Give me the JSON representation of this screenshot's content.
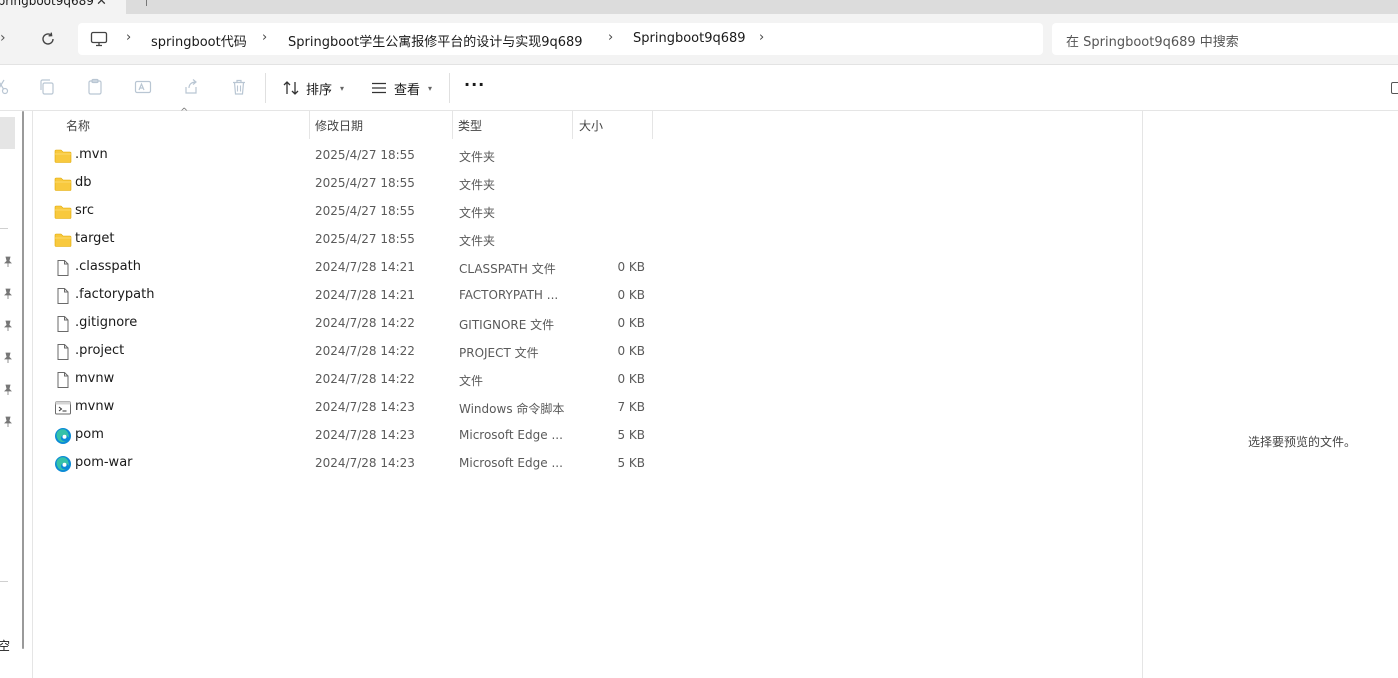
{
  "tab": {
    "title": "Springboot9q689",
    "close_glyph": "✕"
  },
  "address": {
    "breadcrumbs": [
      "springboot代码",
      "Springboot学生公寓报修平台的设计与实现9q689",
      "Springboot9q689"
    ],
    "separator": "›"
  },
  "search": {
    "placeholder": "在 Springboot9q689 中搜索"
  },
  "toolbar": {
    "icons": [
      "cut-icon",
      "copy-icon",
      "paste-icon",
      "rename-icon",
      "share-icon",
      "delete-icon"
    ],
    "sort_label": "排序",
    "view_label": "查看",
    "more_label": "···"
  },
  "columns": {
    "name": "名称",
    "date": "修改日期",
    "type": "类型",
    "size": "大小"
  },
  "files": [
    {
      "name": ".mvn",
      "date": "2025/4/27 18:55",
      "type": "文件夹",
      "size": "",
      "icon": "folder-icon"
    },
    {
      "name": "db",
      "date": "2025/4/27 18:55",
      "type": "文件夹",
      "size": "",
      "icon": "folder-icon"
    },
    {
      "name": "src",
      "date": "2025/4/27 18:55",
      "type": "文件夹",
      "size": "",
      "icon": "folder-icon"
    },
    {
      "name": "target",
      "date": "2025/4/27 18:55",
      "type": "文件夹",
      "size": "",
      "icon": "folder-icon"
    },
    {
      "name": ".classpath",
      "date": "2024/7/28 14:21",
      "type": "CLASSPATH 文件",
      "size": "0 KB",
      "icon": "file-icon"
    },
    {
      "name": ".factorypath",
      "date": "2024/7/28 14:21",
      "type": "FACTORYPATH ...",
      "size": "0 KB",
      "icon": "file-icon"
    },
    {
      "name": ".gitignore",
      "date": "2024/7/28 14:22",
      "type": "GITIGNORE 文件",
      "size": "0 KB",
      "icon": "file-icon"
    },
    {
      "name": ".project",
      "date": "2024/7/28 14:22",
      "type": "PROJECT 文件",
      "size": "0 KB",
      "icon": "file-icon"
    },
    {
      "name": "mvnw",
      "date": "2024/7/28 14:22",
      "type": "文件",
      "size": "0 KB",
      "icon": "file-icon"
    },
    {
      "name": "mvnw",
      "date": "2024/7/28 14:23",
      "type": "Windows 命令脚本",
      "size": "7 KB",
      "icon": "script-icon"
    },
    {
      "name": "pom",
      "date": "2024/7/28 14:23",
      "type": "Microsoft Edge ...",
      "size": "5 KB",
      "icon": "edge-icon"
    },
    {
      "name": "pom-war",
      "date": "2024/7/28 14:23",
      "type": "Microsoft Edge ...",
      "size": "5 KB",
      "icon": "edge-icon"
    }
  ],
  "preview": {
    "message": "选择要预览的文件。"
  },
  "nav": {
    "fragment": "空"
  },
  "colors": {
    "folder": "#f8c93e",
    "accent": "#0078d4"
  }
}
